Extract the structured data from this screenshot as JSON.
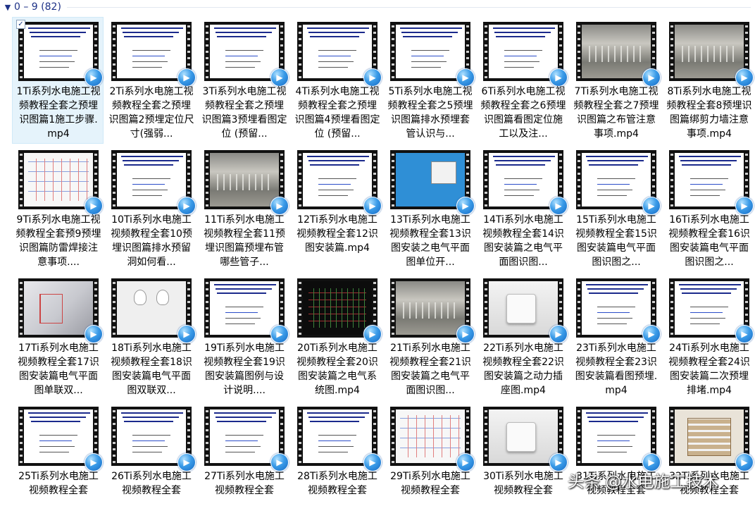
{
  "group": {
    "title": "0 – 9 (82)",
    "collapse_icon": "chevron-down-icon"
  },
  "files": [
    {
      "label": "1Ti系列水电施工视频教程全套之预埋识图篇1施工步骤.mp4",
      "thumb": "doc",
      "selected": true
    },
    {
      "label": "2Ti系列水电施工视频教程全套之预埋识图篇2预埋定位尺寸(强弱...",
      "thumb": "doc"
    },
    {
      "label": "3Ti系列水电施工视频教程全套之预埋识图篇3预埋看图定位 (预留...",
      "thumb": "doc"
    },
    {
      "label": "4Ti系列水电施工视频教程全套之预埋识图篇4预埋看图定位 (预留...",
      "thumb": "doc"
    },
    {
      "label": "5Ti系列水电施工视频教程全套之5预埋识图篇排水预埋套管认识与...",
      "thumb": "doc"
    },
    {
      "label": "6Ti系列水电施工视频教程全套之6预埋识图篇看图定位施工以及注...",
      "thumb": "doc"
    },
    {
      "label": "7Ti系列水电施工视频教程全套之7预埋识图篇之布管注意事项.mp4",
      "thumb": "photo-site"
    },
    {
      "label": "8Ti系列水电施工视频教程全套8预埋识图篇绑剪力墙注意事项.mp4",
      "thumb": "photo-site"
    },
    {
      "label": "9Ti系列水电施工视频教程全套预9预埋识图篇防雷焊接注意事项....",
      "thumb": "cad-light"
    },
    {
      "label": "10Ti系列水电施工视频教程全套10预埋识图篇排水预留洞如何看...",
      "thumb": "doc"
    },
    {
      "label": "11Ti系列水电施工视频教程全套11预埋识图篇预埋布管哪些管子...",
      "thumb": "photo-site"
    },
    {
      "label": "12Ti系列水电施工视频教程全套12识图安装篇.mp4",
      "thumb": "doc"
    },
    {
      "label": "13Ti系列水电施工视频教程全套13识图安装之电气平面图单位开...",
      "thumb": "blue-ui"
    },
    {
      "label": "14Ti系列水电施工视频教程全套14识图安装篇之电气平面图识图...",
      "thumb": "doc"
    },
    {
      "label": "15Ti系列水电施工视频教程全套15识图安装篇电气平面图识图之...",
      "thumb": "doc"
    },
    {
      "label": "16Ti系列水电施工视频教程全套16识图安装篇电气平面图识图之...",
      "thumb": "doc"
    },
    {
      "label": "17Ti系列水电施工视频教程全套17识图安装篇电气平面图单联双...",
      "thumb": "room3d"
    },
    {
      "label": "18Ti系列水电施工视频教程全套18识图安装篇电气平面图双联双...",
      "thumb": "lamps"
    },
    {
      "label": "19Ti系列水电施工视频教程全套19识图安装篇图例与设计说明....",
      "thumb": "doc"
    },
    {
      "label": "20Ti系列水电施工视频教程全套20识图安装篇之电气系统图.mp4",
      "thumb": "cad-dark"
    },
    {
      "label": "21Ti系列水电施工视频教程全套21识图安装篇之电气平面图识图...",
      "thumb": "photo-site"
    },
    {
      "label": "22Ti系列水电施工视频教程全套22识图安装篇之动力插座图.mp4",
      "thumb": "photo-white"
    },
    {
      "label": "23Ti系列水电施工视频教程全套23识图安装篇看图预埋.mp4",
      "thumb": "doc"
    },
    {
      "label": "24Ti系列水电施工视频教程全套24识图安装篇二次预埋排堵.mp4",
      "thumb": "doc"
    },
    {
      "label": "25Ti系列水电施工视频教程全套",
      "thumb": "doc"
    },
    {
      "label": "26Ti系列水电施工视频教程全套",
      "thumb": "doc"
    },
    {
      "label": "27Ti系列水电施工视频教程全套",
      "thumb": "doc"
    },
    {
      "label": "28Ti系列水电施工视频教程全套",
      "thumb": "doc"
    },
    {
      "label": "29Ti系列水电施工视频教程全套",
      "thumb": "cad-light"
    },
    {
      "label": "30Ti系列水电施工视频教程全套",
      "thumb": "photo-white"
    },
    {
      "label": "31Ti系列水电施工视频教程全套",
      "thumb": "doc"
    },
    {
      "label": "32Ti系列水电施工视频教程全套",
      "thumb": "panel"
    }
  ],
  "watermark": "头条 @水电施工技术",
  "colors": {
    "header_text": "#1e3287",
    "selection_bg": "#e5f3fb",
    "selection_border": "#d0e9f8"
  }
}
